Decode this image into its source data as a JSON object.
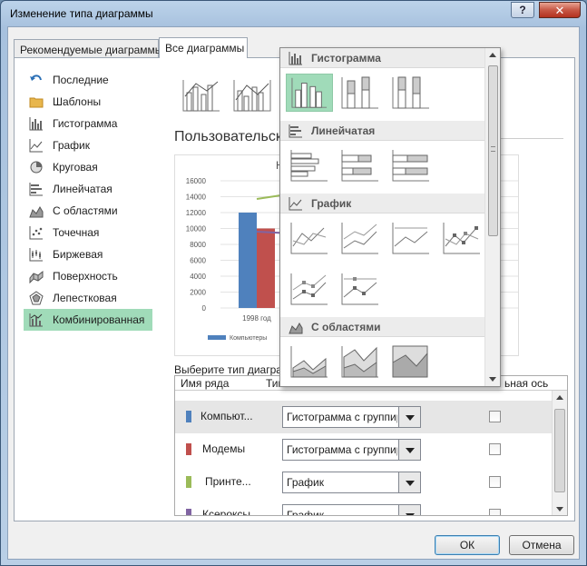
{
  "window": {
    "title": "Изменение типа диаграммы",
    "help_label": "?",
    "close_label": "✕"
  },
  "tabs": [
    {
      "label": "Рекомендуемые диаграммы",
      "active": false
    },
    {
      "label": "Все диаграммы",
      "active": true
    }
  ],
  "chart_types": [
    {
      "label": "Последние",
      "icon": "undo-arrow-icon"
    },
    {
      "label": "Шаблоны",
      "icon": "folder-icon"
    },
    {
      "label": "Гистограмма",
      "icon": "column-chart-icon"
    },
    {
      "label": "График",
      "icon": "line-chart-icon"
    },
    {
      "label": "Круговая",
      "icon": "pie-chart-icon"
    },
    {
      "label": "Линейчатая",
      "icon": "bar-chart-icon"
    },
    {
      "label": "С областями",
      "icon": "area-chart-icon"
    },
    {
      "label": "Точечная",
      "icon": "scatter-chart-icon"
    },
    {
      "label": "Биржевая",
      "icon": "stock-chart-icon"
    },
    {
      "label": "Поверхность",
      "icon": "surface-chart-icon"
    },
    {
      "label": "Лепестковая",
      "icon": "radar-chart-icon"
    },
    {
      "label": "Комбинированная",
      "icon": "combo-chart-icon",
      "selected": true
    }
  ],
  "custom_combo_title": "Пользовательская",
  "preview": {
    "title_fragment": "Н",
    "category_label": "1998 год",
    "legend_label": "Компьютеры",
    "colors": {
      "computers": "#4f81bd",
      "modems": "#c0504d",
      "printers": "#9bbb59",
      "copiers": "#8064a2"
    }
  },
  "chart_data": {
    "type": "bar",
    "y_ticks": [
      "16000",
      "14000",
      "12000",
      "10000",
      "8000",
      "6000",
      "4000",
      "2000",
      "0"
    ],
    "ylim": [
      0,
      16000
    ],
    "categories": [
      "1998 год"
    ],
    "series": [
      {
        "name": "Компьютеры",
        "values": [
          12000
        ]
      },
      {
        "name": "Модемы",
        "values": [
          10000
        ]
      }
    ]
  },
  "series_grid": {
    "caption": "Выберите тип диаграммы",
    "col_name": "Имя ряда",
    "col_type": "Тип диаграммы",
    "col_axis": "ьная ось",
    "rows": [
      {
        "name": "Компьют...",
        "color": "#4f81bd",
        "type": "Гистограмма с группировкой",
        "selected": true
      },
      {
        "name": "Модемы",
        "color": "#c0504d",
        "type": "Гистограмма с группировкой",
        "selected": false
      },
      {
        "name": "Принте...",
        "color": "#9bbb59",
        "type": "График",
        "selected": false
      },
      {
        "name": "Ксероксы",
        "color": "#8064a2",
        "type": "График",
        "selected": false
      }
    ]
  },
  "gallery": {
    "sections": [
      {
        "label": "Гистограмма",
        "icon": "column-chart-icon"
      },
      {
        "label": "Линейчатая",
        "icon": "bar-chart-icon"
      },
      {
        "label": "График",
        "icon": "line-chart-icon"
      },
      {
        "label": "С областями",
        "icon": "area-chart-icon"
      }
    ]
  },
  "buttons": {
    "ok": "ОК",
    "cancel": "Отмена"
  }
}
